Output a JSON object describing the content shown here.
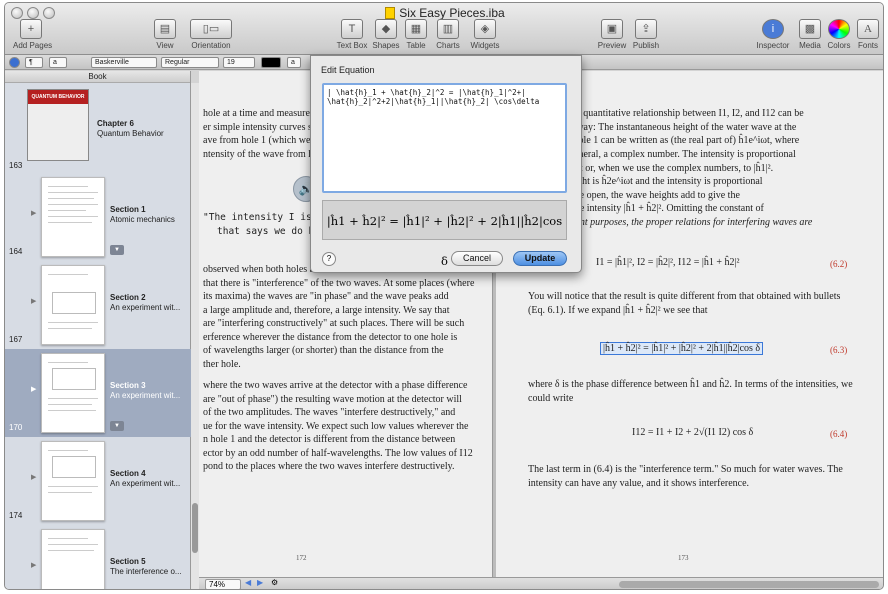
{
  "window": {
    "title": "Six Easy Pieces.iba"
  },
  "toolbar": {
    "add_pages": "Add Pages",
    "view": "View",
    "orientation": "Orientation",
    "text_box": "Text Box",
    "shapes": "Shapes",
    "table": "Table",
    "charts": "Charts",
    "widgets": "Widgets",
    "preview": "Preview",
    "publish": "Publish",
    "inspector": "Inspector",
    "media": "Media",
    "colors": "Colors",
    "fonts": "Fonts"
  },
  "format_bar": {
    "paragraph_style": "¶",
    "char_style": "a",
    "font": "Baskerville",
    "weight": "Regular",
    "size": "19",
    "color": "#000000",
    "char_a": "a"
  },
  "sidebar": {
    "header": "Book",
    "items": [
      {
        "name": "Chapter 6",
        "sub": "Quantum Behavior",
        "page": "163",
        "cover": "QUANTUM BEHAVIOR"
      },
      {
        "name": "Section 1",
        "sub": "Atomic mechanics",
        "page": "164"
      },
      {
        "name": "Section 2",
        "sub": "An experiment wit...",
        "page": "167"
      },
      {
        "name": "Section 3",
        "sub": "An experiment wit...",
        "page": "170"
      },
      {
        "name": "Section 4",
        "sub": "An experiment wit...",
        "page": "174"
      },
      {
        "name": "Section 5",
        "sub": "The interference o...",
        "page": ""
      }
    ]
  },
  "left_page": {
    "lines": [
      "hole at a time and measure th",
      "er simple intensity curves sho",
      "ave from hole 1 (which we fin",
      "ntensity of the wave from hol",
      "\"The intensity I is not",
      "that says we do have",
      "observed when both holes a",
      "that there is \"interference\" of the two waves. At some places (where",
      "its maxima) the waves are \"in phase\" and the wave peaks add",
      "a large amplitude and, therefore, a large intensity. We say that",
      "are \"interfering constructively\" at such places. There will be such",
      "erference wherever the distance from the detector to one hole is",
      "of wavelengths larger (or shorter) than the distance from the",
      "ther hole.",
      "where the two waves arrive at the detector with a phase difference",
      "are \"out of phase\") the resulting wave motion at the detector will",
      "of the two amplitudes. The waves \"interfere destructively,\" and",
      "ue for the wave intensity. We expect such low values wherever the",
      "n hole 1 and the detector is different from the distance between",
      "ector by an odd number of half-wavelengths. The low values of I12",
      "pond to the places where the two waves interfere destructively."
    ],
    "page_number": "172"
  },
  "right_page": {
    "lines": [
      "mber that the quantitative relationship between I1, I2, and I12 can be",
      "e following way: The instantaneous height of the water wave at the",
      "wave from hole 1 can be written as (the real part of) ĥ1e^iωt, where",
      "\" ĥ1 is, in general, a complex number. The intensity is proportional",
      "quared height or, when we use the complex numbers, to |ĥ1|².",
      "ole 2 the height is ĥ2e^iωt and the intensity is proportional",
      "both holes are open, the wave heights add to give the",
      ")e^iωt and the intensity |ĥ1 + ĥ2|². Omitting the constant of",
      "for our present purposes, the proper relations for interfering waves are"
    ],
    "eq1": "I1 = |ĥ1|²,     I2 = |ĥ2|²,     I12 = |ĥ1 + ĥ2|²",
    "eq1_num": "(6.2)",
    "para2": [
      "You will notice that the result is quite different from that obtained with bullets",
      "(Eq. 6.1). If we expand |ĥ1 + ĥ2|² we see that"
    ],
    "eq2": "|ĥ1 + ĥ2|² = |ĥ1|² + |ĥ2|² + 2|ĥ1||ĥ2|cos δ",
    "eq2_num": "(6.3)",
    "para3": [
      "where δ is the phase difference between ĥ1 and ĥ2. In terms of the intensities, we",
      "could write"
    ],
    "eq3": "I12 = I1 + I2 + 2√(I1 I2) cos δ",
    "eq3_num": "(6.4)",
    "para4": [
      "The last term in (6.4) is the \"interference term.\" So much for water waves. The",
      "intensity can have any value, and it shows interference."
    ],
    "page_number": "173"
  },
  "dialog": {
    "title": "Edit Equation",
    "latex": "| \\hat{h}_1 + \\hat{h}_2|^2 = |\\hat{h}_1|^2+|\n\\hat{h}_2|^2+2|\\hat{h}_1||\\hat{h}_2| \\cos\\delta",
    "preview": "|ĥ1 + ĥ2|² = |ĥ1|² + |ĥ2|² + 2|ĥ1||ĥ2|cos δ",
    "help": "?",
    "cancel": "Cancel",
    "update": "Update"
  },
  "bottom_bar": {
    "zoom": "74%"
  }
}
